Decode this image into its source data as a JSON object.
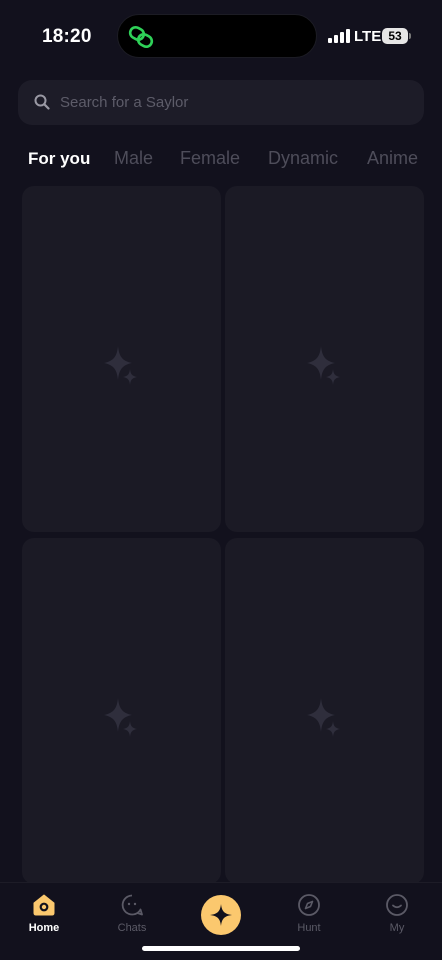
{
  "status_bar": {
    "time": "18:20",
    "network": "LTE",
    "battery": "53"
  },
  "search": {
    "placeholder": "Search for a Saylor"
  },
  "tabs": [
    {
      "label": "For you",
      "active": true
    },
    {
      "label": "Male",
      "active": false
    },
    {
      "label": "Female",
      "active": false
    },
    {
      "label": "Dynamic",
      "active": false
    },
    {
      "label": "Anime",
      "active": false
    }
  ],
  "cards": [
    {
      "state": "loading-placeholder",
      "icon": "sparkle-icon"
    },
    {
      "state": "loading-placeholder",
      "icon": "sparkle-icon"
    },
    {
      "state": "loading-placeholder",
      "icon": "sparkle-icon"
    },
    {
      "state": "loading-placeholder",
      "icon": "sparkle-icon"
    }
  ],
  "bottom_nav": {
    "items": [
      {
        "label": "Home",
        "icon": "home-icon",
        "active": true
      },
      {
        "label": "Chats",
        "icon": "chat-bubble-icon",
        "active": false
      },
      {
        "label": "",
        "icon": "sparkle-icon",
        "active": false
      },
      {
        "label": "Hunt",
        "icon": "compass-icon",
        "active": false
      },
      {
        "label": "My",
        "icon": "smiley-icon",
        "active": false
      }
    ]
  },
  "colors": {
    "background": "#12111d",
    "card": "#1b1a25",
    "accent": "#fbc86e",
    "island_icon": "#2fd158",
    "inactive_text": "#4e4d5a"
  }
}
